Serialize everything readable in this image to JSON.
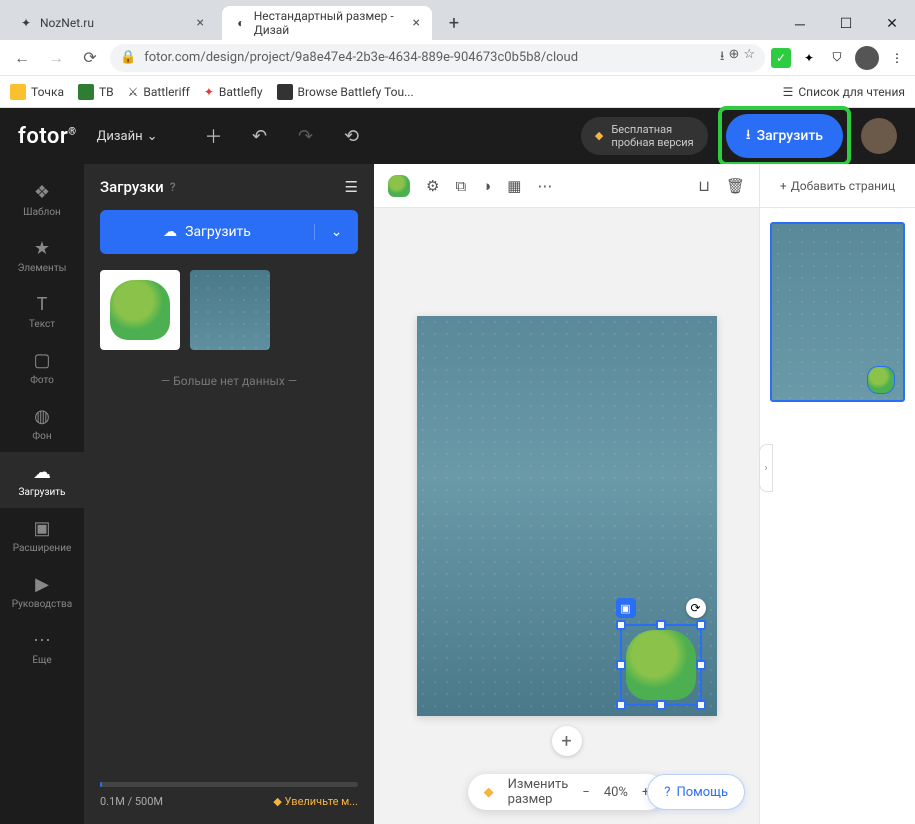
{
  "browser": {
    "tabs": [
      {
        "title": "NozNet.ru",
        "active": false
      },
      {
        "title": "Нестандартный размер - Дизай",
        "active": true
      }
    ],
    "url": "fotor.com/design/project/9a8e47e4-2b3e-4634-889e-904673c0b5b8/cloud",
    "bookmarks": [
      "Точка",
      "ТВ",
      "Battleriff",
      "Battlefly",
      "Browse Battlefy Tou..."
    ],
    "reading_list": "Список для чтения"
  },
  "header": {
    "logo": "fotor",
    "design_menu": "Дизайн",
    "trial_line1": "Бесплатная",
    "trial_line2": "пробная версия",
    "download": "Загрузить"
  },
  "rail": {
    "items": [
      {
        "icon": "❖",
        "label": "Шаблон"
      },
      {
        "icon": "★",
        "label": "Элементы"
      },
      {
        "icon": "T",
        "label": "Текст"
      },
      {
        "icon": "▢",
        "label": "Фото"
      },
      {
        "icon": "◍",
        "label": "Фон"
      },
      {
        "icon": "☁",
        "label": "Загрузить"
      },
      {
        "icon": "▣",
        "label": "Расширение"
      },
      {
        "icon": "▶",
        "label": "Руководства"
      },
      {
        "icon": "⋯",
        "label": "Еще"
      }
    ],
    "active_index": 5
  },
  "panel": {
    "title": "Загрузки",
    "upload_btn": "Загрузить",
    "no_more": "— Больше нет данных —",
    "storage_used": "0.1M",
    "storage_total": "500M",
    "upgrade": "Увеличьте м..."
  },
  "canvas": {
    "resize_label": "Изменить размер",
    "zoom": "40%"
  },
  "right": {
    "add_page": "Добавить страниц"
  },
  "help": "Помощь"
}
